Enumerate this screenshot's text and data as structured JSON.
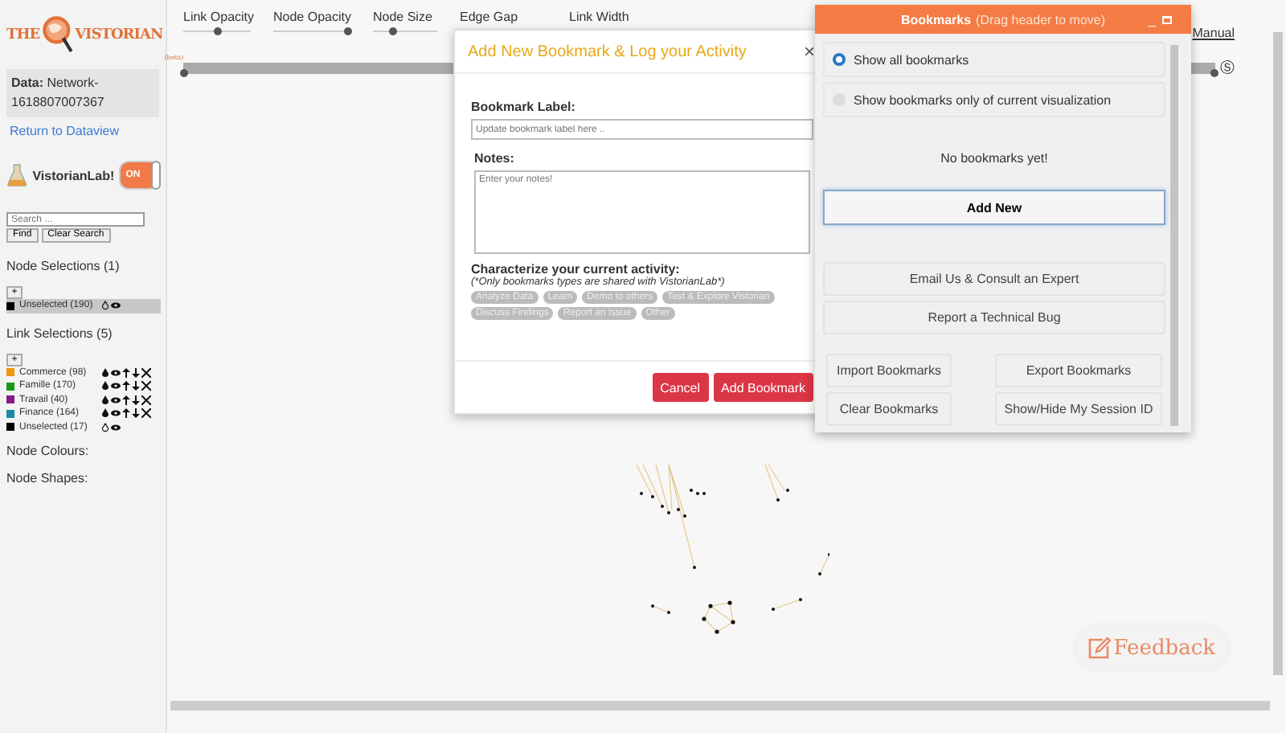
{
  "logo": {
    "left": "THE",
    "right": "VISTORIAN",
    "badge": "(beta)"
  },
  "sidebar": {
    "data_label": "Data:",
    "data_value": "Network-1618807007367",
    "return_link": "Return to Dataview",
    "lab": {
      "label": "VistorianLab!",
      "toggle": {
        "label": "ON",
        "on": true
      }
    },
    "search": {
      "placeholder": "Search ...",
      "buttons": [
        "Find",
        "Clear Search"
      ]
    },
    "node_selections": {
      "title": "Node Selections (1)",
      "add": "+",
      "items": [
        {
          "label": "Unselected (190)",
          "color": "#000000",
          "selected": true,
          "kind": "default"
        }
      ]
    },
    "link_selections": {
      "title": "Link Selections (5)",
      "add": "+",
      "items": [
        {
          "label": "Commerce (98)",
          "color": "#f0960a",
          "selected": false,
          "kind": "custom"
        },
        {
          "label": "Famille (170)",
          "color": "#1a9a1a",
          "selected": false,
          "kind": "custom"
        },
        {
          "label": "Travail (40)",
          "color": "#8b1a8b",
          "selected": false,
          "kind": "custom"
        },
        {
          "label": "Finance (164)",
          "color": "#1a8aaa",
          "selected": false,
          "kind": "custom"
        },
        {
          "label": "Unselected (17)",
          "color": "#000000",
          "selected": false,
          "kind": "default"
        }
      ]
    },
    "sections": [
      "Node Colours:",
      "Node Shapes:"
    ]
  },
  "toolbar": {
    "sliders": [
      {
        "label": "Link Opacity",
        "level": 0.5
      },
      {
        "label": "Node Opacity",
        "level": 0.95
      },
      {
        "label": "Node Size",
        "level": 0.3
      },
      {
        "label": "Edge Gap"
      },
      {
        "label": "Link Width"
      }
    ],
    "manual_link": "Manual",
    "time_marker": "Ⓢ",
    "time_range": {
      "level": 1
    }
  },
  "modal": {
    "title": "Add New Bookmark & Log your Activity",
    "close": "×",
    "label_title": "Bookmark Label:",
    "label_placeholder": "Update bookmark label here ..",
    "notes_title": "Notes:",
    "notes_placeholder": "Enter your notes!",
    "activity_title": "Characterize your current activity:",
    "activity_note": "(*Only bookmarks types are shared with VistorianLab*)",
    "tags": [
      {
        "label": "Analyze Data",
        "selected": false
      },
      {
        "label": "Learn",
        "selected": false
      },
      {
        "label": "Demo to others",
        "selected": false
      },
      {
        "label": "Test & Explore Vistorian",
        "selected": false
      },
      {
        "label": "Discuss Findings",
        "selected": false
      },
      {
        "label": "Report an Issue",
        "selected": false
      },
      {
        "label": "Other",
        "selected": false
      }
    ],
    "buttons": [
      "Cancel",
      "Add Bookmark"
    ]
  },
  "bookmarks": {
    "title": "Bookmarks",
    "hint": "(Drag header to move)",
    "minimize": "_",
    "filters": [
      {
        "label": "Show all bookmarks",
        "selected": true
      },
      {
        "label": "Show bookmarks only of current visualization",
        "selected": false
      }
    ],
    "empty": "No bookmarks yet!",
    "add_new": "Add New",
    "actions": [
      "Email Us & Consult an Expert",
      "Report a Technical Bug"
    ],
    "grid_buttons": [
      "Import Bookmarks",
      "Export Bookmarks",
      "Clear Bookmarks",
      "Show/Hide My Session ID"
    ]
  },
  "feedback": "Feedback"
}
